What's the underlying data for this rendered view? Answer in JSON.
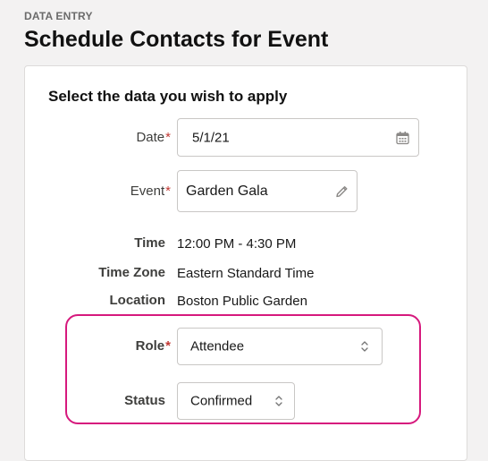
{
  "header": {
    "eyebrow": "DATA ENTRY",
    "title": "Schedule Contacts for Event"
  },
  "form": {
    "section_title": "Select the data you wish to apply",
    "required_marker": "*",
    "date": {
      "label": "Date",
      "value": "5/1/21",
      "icon": "calendar-icon"
    },
    "event": {
      "label": "Event",
      "value": "Garden Gala",
      "icon": "pencil-icon"
    },
    "time": {
      "label": "Time",
      "value": "12:00 PM - 4:30 PM"
    },
    "time_zone": {
      "label": "Time Zone",
      "value": "Eastern Standard Time"
    },
    "location": {
      "label": "Location",
      "value": "Boston Public Garden"
    },
    "role": {
      "label": "Role",
      "value": "Attendee",
      "icon": "sort-chevrons-icon"
    },
    "status": {
      "label": "Status",
      "value": "Confirmed",
      "icon": "sort-chevrons-icon"
    }
  },
  "colors": {
    "highlight": "#d6197d",
    "required": "#c23934"
  }
}
